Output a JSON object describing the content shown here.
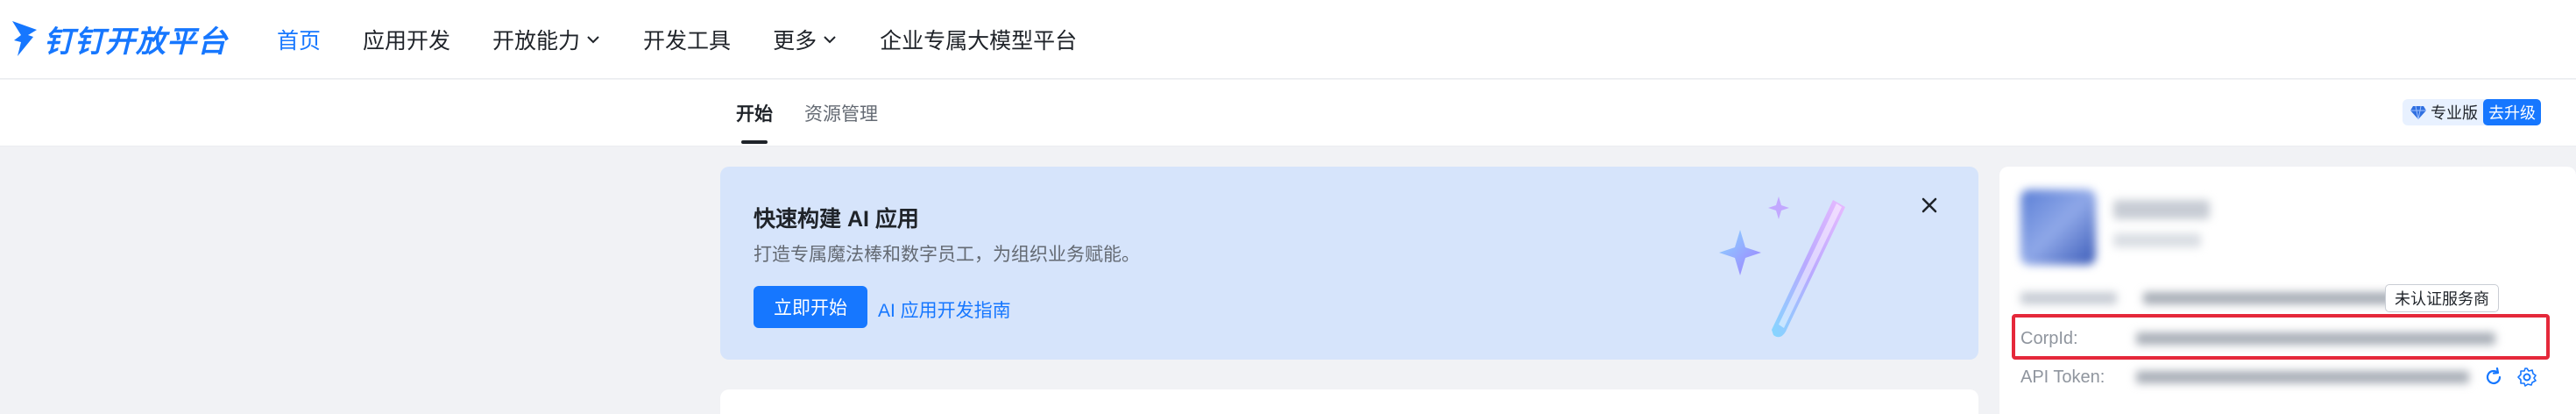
{
  "brand": {
    "name": "钉钉开放平台",
    "color": "#1677ff"
  },
  "nav": {
    "items": [
      {
        "label": "首页",
        "active": true,
        "dropdown": false
      },
      {
        "label": "应用开发",
        "active": false,
        "dropdown": false
      },
      {
        "label": "开放能力",
        "active": false,
        "dropdown": true
      },
      {
        "label": "开发工具",
        "active": false,
        "dropdown": false
      },
      {
        "label": "更多",
        "active": false,
        "dropdown": true
      },
      {
        "label": "企业专属大模型平台",
        "active": false,
        "dropdown": false
      }
    ]
  },
  "subnav": {
    "tabs": [
      {
        "label": "开始",
        "active": true
      },
      {
        "label": "资源管理",
        "active": false
      }
    ],
    "edition": {
      "label": "专业版",
      "upgrade_label": "去升级",
      "icon": "diamond-icon"
    }
  },
  "banner": {
    "title": "快速构建 AI 应用",
    "description": "打造专属魔法棒和数字员工，为组织业务赋能。",
    "primary_button": "立即开始",
    "guide_link": "AI 应用开发指南",
    "close_icon": "close-icon",
    "illustration": "magic-wand-icon"
  },
  "org_panel": {
    "auth_badge": "未认证服务商",
    "corp_id_label": "CorpId:",
    "api_token_label": "API Token:",
    "refresh_icon": "refresh-icon",
    "settings_icon": "settings-icon",
    "highlight_color": "#e5283a"
  }
}
